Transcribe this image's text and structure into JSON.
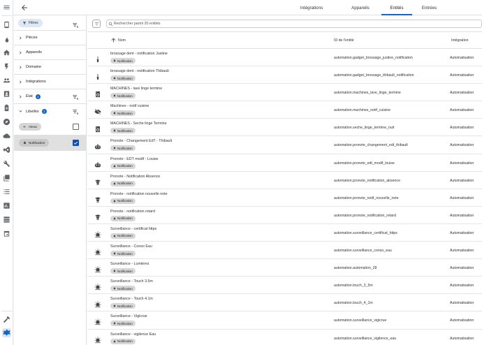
{
  "tabs": [
    {
      "label": "Intégrations",
      "selected": false
    },
    {
      "label": "Appareils",
      "selected": false
    },
    {
      "label": "Entités",
      "selected": true
    },
    {
      "label": "Entrées",
      "selected": false
    }
  ],
  "filter_panel": {
    "filters_label": "Filtres",
    "sections": [
      {
        "label": "Pièces",
        "badge": ""
      },
      {
        "label": "Appareils",
        "badge": ""
      },
      {
        "label": "Domaine",
        "badge": ""
      },
      {
        "label": "Intégrations",
        "badge": ""
      },
      {
        "label": "État",
        "badge": "1"
      }
    ],
    "labels_section": {
      "label": "Libellés",
      "badge": "1"
    },
    "labels": [
      {
        "name": "Alexa",
        "checked": false
      },
      {
        "name": "Notification",
        "checked": true
      }
    ]
  },
  "search": {
    "placeholder": "Rechercher parmi 20 entités"
  },
  "columns": {
    "name": "Nom",
    "entity_id": "ID de l'entité",
    "integration": "Intégration"
  },
  "rows": [
    {
      "icon": "toothbrush-icon",
      "name": "brossage dent - notification Justine",
      "chip": "Notification",
      "entity_id": "automation.gadget_brossage_justine_notification",
      "integration": "Automatisation"
    },
    {
      "icon": "toothbrush-icon",
      "name": "brossage dent - notification Thibault",
      "chip": "Notification",
      "entity_id": "automation.gadget_brossage_thibault_notification",
      "integration": "Automatisation"
    },
    {
      "icon": "washing-machine-icon",
      "name": "MACHINES - lave linge termine",
      "chip": "Notification",
      "entity_id": "automation.machines_lave_linge_termine",
      "integration": "Automatisation"
    },
    {
      "icon": "eye-off-icon",
      "name": "Machines - notif cuisine",
      "chip": "Notification",
      "entity_id": "automation.machines_notif_cuisine",
      "integration": "Automatisation"
    },
    {
      "icon": "washing-machine-icon",
      "name": "MACHINES - Seche linge Termine",
      "chip": "Notification",
      "entity_id": "automation.seche_linge_termine_nuit",
      "integration": "Automatisation"
    },
    {
      "icon": "robot-icon",
      "name": "Pronote - Changement EdT - Thibault",
      "chip": "Notification",
      "entity_id": "automation.pronote_changement_edt_thibault",
      "integration": "Automatisation"
    },
    {
      "icon": "robot-icon",
      "name": "Pronote - EDT modif - Louise",
      "chip": "Notification",
      "entity_id": "automation.pronote_edt_modif_louise",
      "integration": "Automatisation"
    },
    {
      "icon": "student-icon",
      "name": "Pronote - Notification Absence",
      "chip": "Notification",
      "entity_id": "automation.pronote_notification_absence",
      "integration": "Automatisation"
    },
    {
      "icon": "student-icon",
      "name": "Pronote - notification nouvelle note",
      "chip": "Notification",
      "entity_id": "automation.pronote_notif_nouvelle_note",
      "integration": "Automatisation"
    },
    {
      "icon": "student-icon",
      "name": "Pronote - notification retard",
      "chip": "Notification",
      "entity_id": "automation.pronote_notification_retard",
      "integration": "Automatisation"
    },
    {
      "icon": "alarm-light-icon",
      "name": "Surveillance - certificat https",
      "chip": "Notification",
      "entity_id": "automation.surveillance_certificat_https",
      "integration": "Automatisation"
    },
    {
      "icon": "alarm-light-icon",
      "name": "Surveillance - Conso Eau",
      "chip": "Notification",
      "entity_id": "automation.surveillance_conso_eau",
      "integration": "Automatisation"
    },
    {
      "icon": "alarm-light-icon",
      "name": "Surveillance - Lumières",
      "chip": "Notification",
      "entity_id": "automation.automation_28",
      "integration": "Automatisation"
    },
    {
      "icon": "alarm-light-icon",
      "name": "Surveillance - Touch 3.5m",
      "chip": "Notification",
      "entity_id": "automation.touch_3_5m",
      "integration": "Automatisation"
    },
    {
      "icon": "alarm-light-icon",
      "name": "Surveillance - Touch 4.1m",
      "chip": "Notification",
      "entity_id": "automation.touch_4_1m",
      "integration": "Automatisation"
    },
    {
      "icon": "alarm-light-icon",
      "name": "Surveillance - Vigicrue",
      "chip": "Notification",
      "entity_id": "automation.surveillance_vigicrue",
      "integration": "Automatisation"
    },
    {
      "icon": "alarm-light-icon",
      "name": "Surveillance - vigilence Eau",
      "chip": "Notification",
      "entity_id": "automation.surveillance_vigilence_eau",
      "integration": "Automatisation"
    }
  ],
  "colors": {
    "accent": "#1565c0",
    "chip": "#d7d7d7",
    "selected_row": "#e0e0e0"
  }
}
